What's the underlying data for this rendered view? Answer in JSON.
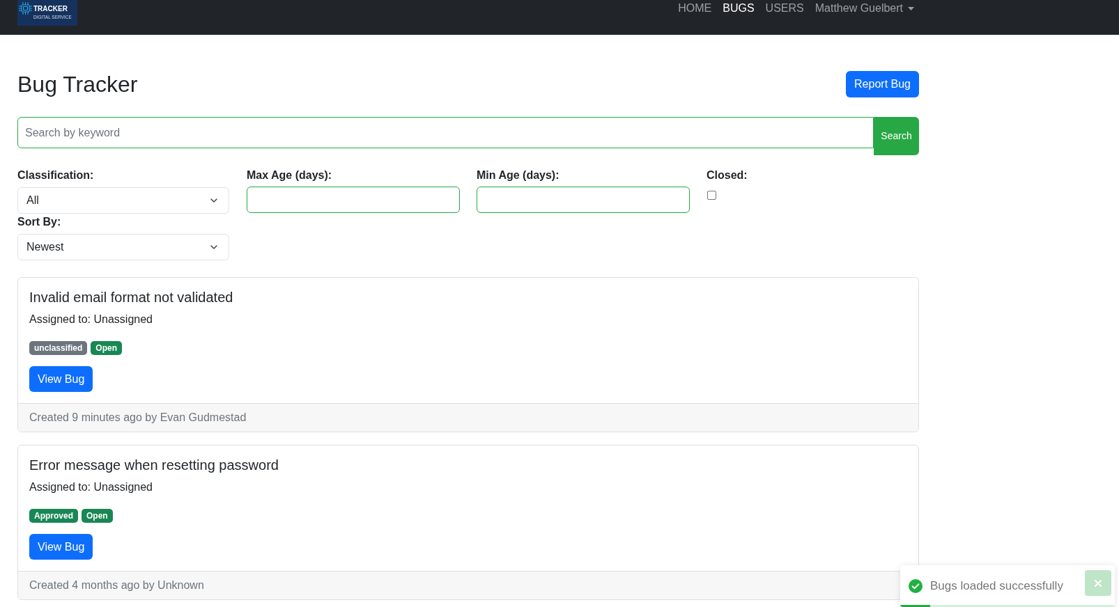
{
  "navbar": {
    "logo": {
      "lines": [
        "TRACKER",
        "DIGITAL SERVICE"
      ]
    },
    "links": [
      {
        "label": "HOME",
        "selected": false
      },
      {
        "label": "BUGS",
        "selected": true
      },
      {
        "label": "USERS",
        "selected": false
      }
    ],
    "user_menu": {
      "label": "Matthew Guelbert"
    }
  },
  "page": {
    "title": "Bug Tracker",
    "report_button": "Report Bug"
  },
  "search": {
    "placeholder": "Search by keyword",
    "button": "Search"
  },
  "filters": {
    "classification": {
      "label": "Classification:",
      "value": "All"
    },
    "sort_by": {
      "label": "Sort By:",
      "value": "Newest"
    },
    "max_age": {
      "label": "Max Age (days):"
    },
    "min_age": {
      "label": "Min Age (days):"
    },
    "closed": {
      "label": "Closed:",
      "checked": false
    }
  },
  "bugs": [
    {
      "title": "Invalid email format not validated",
      "assigned": "Assigned to: Unassigned",
      "badges": [
        {
          "label": "unclassified",
          "color": "#6c757d"
        },
        {
          "label": "Open",
          "color": "#198754"
        }
      ],
      "button": "View Bug",
      "footer": "Created 9 minutes ago by Evan Gudmestad"
    },
    {
      "title": "Error message when resetting password",
      "assigned": "Assigned to: Unassigned",
      "badges": [
        {
          "label": "Approved",
          "color": "#198754"
        },
        {
          "label": "Open",
          "color": "#198754"
        }
      ],
      "button": "View Bug",
      "footer": "Created 4 months ago by Unknown"
    }
  ],
  "toast": {
    "message": "Bugs loaded successfully",
    "level": 0.14
  }
}
